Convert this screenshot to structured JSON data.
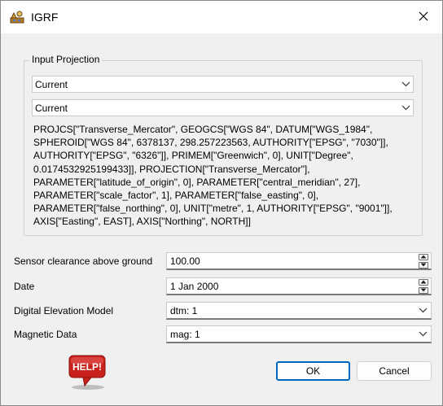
{
  "window": {
    "title": "IGRF",
    "icon": "app-icon",
    "close_icon": "close-icon"
  },
  "input_projection": {
    "label": "Input Projection",
    "combo1": "Current",
    "combo2": "Current",
    "wkt": "PROJCS[\"Transverse_Mercator\", GEOGCS[\"WGS 84\", DATUM[\"WGS_1984\", SPHEROID[\"WGS 84\", 6378137, 298.257223563, AUTHORITY[\"EPSG\", \"7030\"]], AUTHORITY[\"EPSG\", \"6326\"]], PRIMEM[\"Greenwich\", 0], UNIT[\"Degree\", 0.0174532925199433]], PROJECTION[\"Transverse_Mercator\"], PARAMETER[\"latitude_of_origin\", 0], PARAMETER[\"central_meridian\", 27], PARAMETER[\"scale_factor\", 1], PARAMETER[\"false_easting\", 0], PARAMETER[\"false_northing\", 0], UNIT[\"metre\", 1, AUTHORITY[\"EPSG\", \"9001\"]], AXIS[\"Easting\", EAST], AXIS[\"Northing\", NORTH]]"
  },
  "form": {
    "sensor_label": "Sensor clearance above ground",
    "sensor_value": "100.00",
    "date_label": "Date",
    "date_value": "1 Jan 2000",
    "dem_label": "Digital Elevation Model",
    "dem_value": "dtm: 1",
    "mag_label": "Magnetic Data",
    "mag_value": "mag: 1"
  },
  "buttons": {
    "help": "HELP!",
    "ok": "OK",
    "cancel": "Cancel"
  },
  "colors": {
    "accent": "#0067c0",
    "help_red": "#c8201b"
  }
}
